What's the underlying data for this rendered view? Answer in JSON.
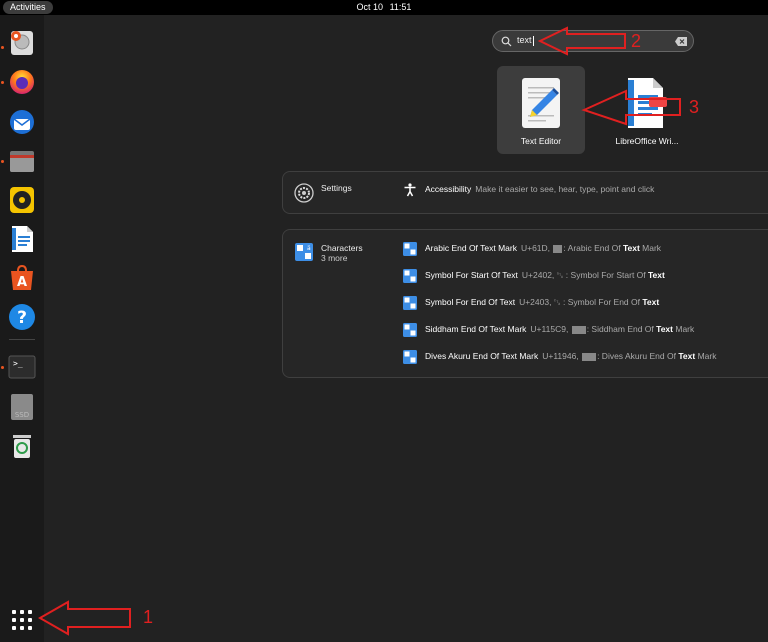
{
  "topbar": {
    "activities": "Activities",
    "date": "Oct 10",
    "time": "11:51"
  },
  "dock": {
    "items": [
      {
        "name": "disk-usage-icon",
        "running": true
      },
      {
        "name": "firefox-icon",
        "running": true
      },
      {
        "name": "thunderbird-icon",
        "running": false
      },
      {
        "name": "files-icon",
        "running": true
      },
      {
        "name": "rhythmbox-icon",
        "running": false
      },
      {
        "name": "libreoffice-writer-icon",
        "running": false
      },
      {
        "name": "app-center-icon",
        "running": false
      },
      {
        "name": "help-icon",
        "running": false
      },
      {
        "name": "terminal-icon",
        "running": true
      },
      {
        "name": "ssd-drive-icon",
        "running": false
      },
      {
        "name": "trash-icon",
        "running": false
      }
    ],
    "show_apps": "show-apps-grid-icon"
  },
  "search": {
    "value": "text"
  },
  "apps": [
    {
      "label": "Text Editor",
      "icon": "text-editor-icon",
      "selected": true
    },
    {
      "label": "LibreOffice Wri...",
      "icon": "libreoffice-writer-icon",
      "selected": false
    }
  ],
  "settings": {
    "provider": "Settings",
    "result_title": "Accessibility",
    "result_desc": "Make it easier to see, hear, type, point and click"
  },
  "characters": {
    "provider": "Characters",
    "more": "3 more",
    "results": [
      {
        "title": "Arabic End Of Text Mark",
        "code": "U+61D,",
        "desc_pre": ": Arabic End Of ",
        "desc_bold": "Text",
        "desc_post": " Mark"
      },
      {
        "title": "Symbol For Start Of Text",
        "code": "U+2402, ␂ :",
        "desc_pre": " Symbol For Start Of ",
        "desc_bold": "Text",
        "desc_post": ""
      },
      {
        "title": "Symbol For End Of Text",
        "code": "U+2403, ␃ :",
        "desc_pre": " Symbol For End Of ",
        "desc_bold": "Text",
        "desc_post": ""
      },
      {
        "title": "Siddham End Of Text Mark",
        "code": "U+115C9,",
        "desc_pre": ": Siddham End Of ",
        "desc_bold": "Text",
        "desc_post": " Mark"
      },
      {
        "title": "Dives Akuru End Of Text Mark",
        "code": "U+11946,",
        "desc_pre": ": Dives Akuru End Of ",
        "desc_bold": "Text",
        "desc_post": " Mark"
      }
    ]
  },
  "annotations": [
    {
      "label": "1",
      "color": "#e02020"
    },
    {
      "label": "2",
      "color": "#e02020"
    },
    {
      "label": "3",
      "color": "#e02020"
    }
  ]
}
